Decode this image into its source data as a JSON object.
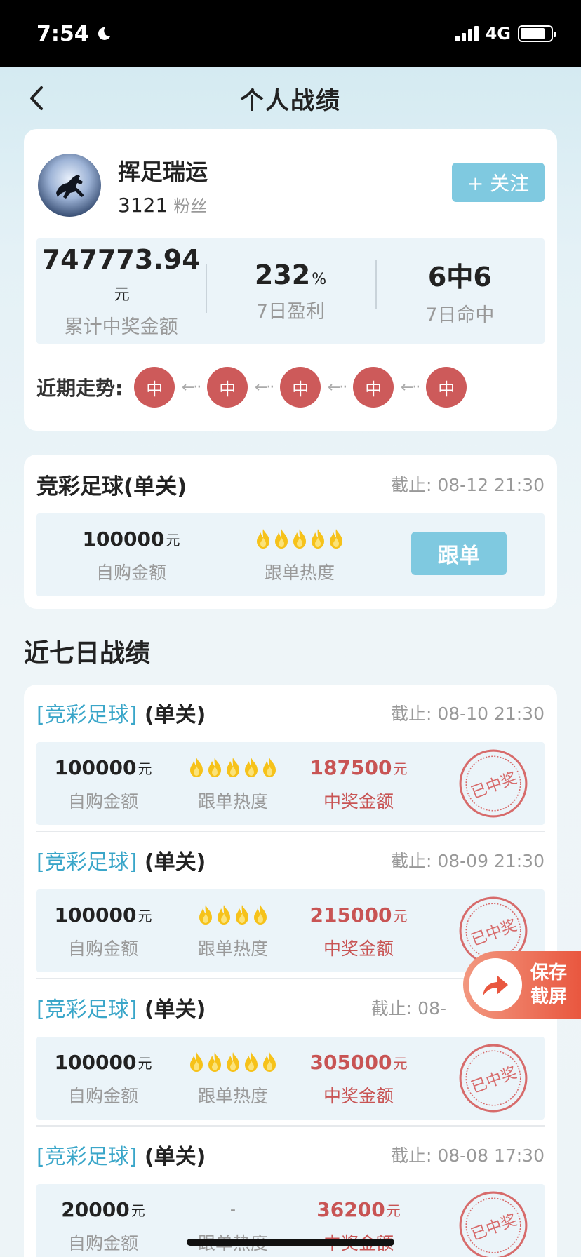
{
  "status_bar": {
    "time": "7:54",
    "network": "4G",
    "battery_level": 0.8
  },
  "nav": {
    "title": "个人战绩"
  },
  "profile": {
    "username": "挥足瑞运",
    "fans_count": "3121",
    "fans_label": "粉丝",
    "follow_label": "+ 关注",
    "stats": [
      {
        "value": "747773.94",
        "unit": "元",
        "label": "累计中奖金额"
      },
      {
        "value": "232",
        "unit": "%",
        "label": "7日盈利"
      },
      {
        "value": "6中6",
        "unit": "",
        "label": "7日命中"
      }
    ],
    "trend_label": "近期走势:",
    "trend_items": [
      "中",
      "中",
      "中",
      "中",
      "中"
    ],
    "trend_arrow": "←··"
  },
  "current": {
    "title": "竞彩足球(单关)",
    "deadline": "截止:  08-12 21:30",
    "amount": "100000",
    "amount_unit": "元",
    "amount_label": "自购金额",
    "heat_flames": 5,
    "heat_label": "跟单热度",
    "follow_button": "跟单"
  },
  "section_title": "近七日战绩",
  "records": [
    {
      "lotto": "[竞彩足球]",
      "type": "(单关)",
      "deadline": "截止:  08-10 21:30",
      "amount": "100000",
      "unit": "元",
      "amount_label": "自购金额",
      "heat_flames": 5,
      "heat_label": "跟单热度",
      "prize": "187500",
      "prize_label": "中奖金额",
      "stamp": "已中奖"
    },
    {
      "lotto": "[竞彩足球]",
      "type": "(单关)",
      "deadline": "截止:  08-09 21:30",
      "amount": "100000",
      "unit": "元",
      "amount_label": "自购金额",
      "heat_flames": 4,
      "heat_label": "跟单热度",
      "prize": "215000",
      "prize_label": "中奖金额",
      "stamp": "已中奖"
    },
    {
      "lotto": "[竞彩足球]",
      "type": "(单关)",
      "deadline": "截止:  08-",
      "amount": "100000",
      "unit": "元",
      "amount_label": "自购金额",
      "heat_flames": 5,
      "heat_label": "跟单热度",
      "prize": "305000",
      "prize_label": "中奖金额",
      "stamp": "已中奖"
    },
    {
      "lotto": "[竞彩足球]",
      "type": "(单关)",
      "deadline": "截止:  08-08 17:30",
      "amount": "20000",
      "unit": "元",
      "amount_label": "自购金额",
      "heat_flames": 0,
      "heat_dash": "-",
      "heat_label": "跟单热度",
      "prize": "36200",
      "prize_label": "中奖金额",
      "stamp": "已中奖"
    }
  ],
  "save_button": {
    "line1": "保存",
    "line2": "截屏"
  },
  "colors": {
    "accent": "#7fc9e0",
    "win_red": "#c85454",
    "link_blue": "#3aa6c9"
  }
}
